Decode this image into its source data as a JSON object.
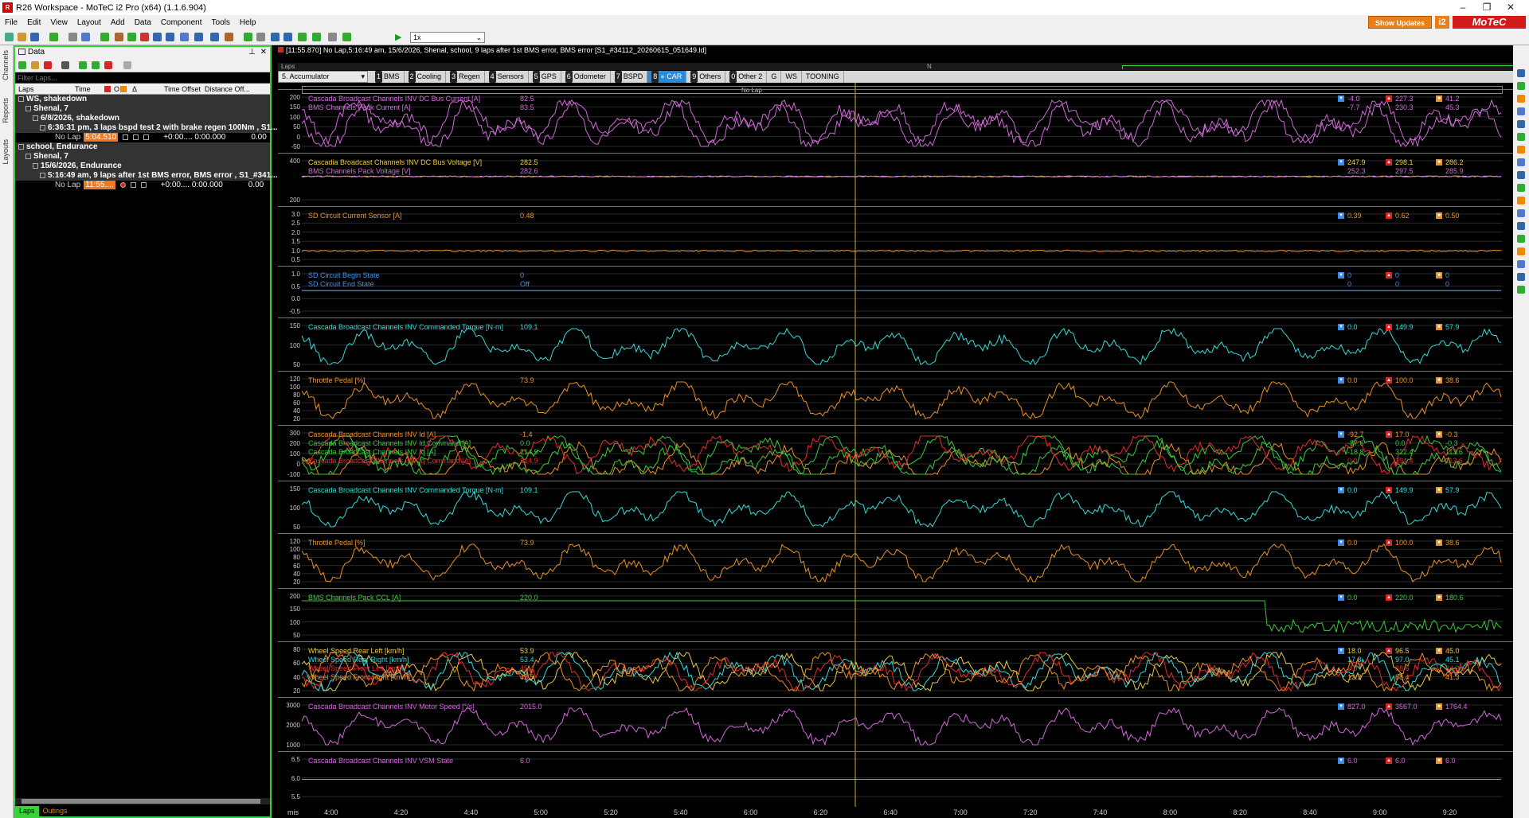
{
  "window": {
    "title": "R26 Workspace - MoTeC i2 Pro (x64) (1.1.6.904)",
    "icon": "R",
    "minimize": "–",
    "restore": "❐",
    "close": "✕"
  },
  "menu": [
    "File",
    "Edit",
    "View",
    "Layout",
    "Add",
    "Data",
    "Component",
    "Tools",
    "Help"
  ],
  "brand": {
    "show_updates": "Show Updates",
    "i2": "i2",
    "motec": "MoTeC"
  },
  "zoom": "1x",
  "left_vertical_tabs": [
    "Channels",
    "Reports",
    "Layouts"
  ],
  "data_panel": {
    "title": "Data",
    "filter_placeholder": "Filter Laps...",
    "columns": [
      "Laps",
      "Time",
      "O",
      "Δ",
      "Time Offset",
      "Distance Off..."
    ],
    "rows": [
      {
        "text": "WS, shakedown",
        "level": 0,
        "group": true
      },
      {
        "text": "Shenal, 7",
        "level": 1,
        "group": true
      },
      {
        "text": "6/8/2026, shakedown",
        "level": 2,
        "group": true
      },
      {
        "text": "6:36:31 pm, 3 laps bspd test 2 with brake regen 100Nm , S1...",
        "level": 3,
        "group": true
      },
      {
        "text": "No Lap",
        "time": "5:04.510",
        "offset": "+0:00.... 0:00.000",
        "dist": "0.00",
        "level": 4
      },
      {
        "text": "school, Endurance",
        "level": 0,
        "group": true
      },
      {
        "text": "Shenal, 7",
        "level": 1,
        "group": true
      },
      {
        "text": "15/6/2026, Endurance",
        "level": 2,
        "group": true
      },
      {
        "text": "5:16:49 am, 9 laps after 1st BMS error, BMS error , S1_#341...",
        "level": 3,
        "group": true
      },
      {
        "text": "No Lap",
        "time": "11:55....",
        "offset": "+0:00.... 0:00.000",
        "dist": "0.00",
        "level": 4
      }
    ],
    "bottom_tabs": [
      "Laps",
      "Outings"
    ]
  },
  "info_bar": "[11:55.870] No Lap,5:16:49 am, 15/6/2026, Shenal, school, 9 laps after 1st BMS error, BMS error [S1_#34112_20260615_051649.ld]",
  "laps_bar": {
    "label": "Laps",
    "marker": "N"
  },
  "worksheet_selector": "5. Accumulator",
  "tabs": [
    {
      "num": "1",
      "label": "BMS"
    },
    {
      "num": "2",
      "label": "Cooling"
    },
    {
      "num": "3",
      "label": "Regen"
    },
    {
      "num": "4",
      "label": "Sensors"
    },
    {
      "num": "5",
      "label": "GPS"
    },
    {
      "num": "6",
      "label": "Odometer"
    },
    {
      "num": "7",
      "label": "BSPD"
    },
    {
      "num": "8",
      "label": "CAR",
      "active": true
    },
    {
      "num": "9",
      "label": "Others"
    },
    {
      "num": "0",
      "label": "Other 2"
    },
    {
      "num": "",
      "label": "G"
    },
    {
      "num": "",
      "label": "WS"
    },
    {
      "num": "",
      "label": "TOONING"
    }
  ],
  "no_lap_label": "No Lap",
  "x_axis": {
    "unit": "mis",
    "ticks": [
      "4:00",
      "4:20",
      "4:40",
      "5:00",
      "5:20",
      "5:40",
      "6:00",
      "6:20",
      "6:40",
      "7:00",
      "7:20",
      "7:40",
      "8:00",
      "8:20",
      "8:40",
      "9:00",
      "9:20"
    ]
  },
  "panels": [
    {
      "yticks": [
        "200",
        "150",
        "100",
        "50",
        "0",
        "-50"
      ],
      "channels": [
        {
          "name": "Cascada Broadcast Channels INV DC Bus Current [A]",
          "value": "82.5",
          "min": "-4.0",
          "max": "227.3",
          "avg": "41.2",
          "color": "#d06ad8"
        },
        {
          "name": "BMS Channels Pack Current [A]",
          "value": "83.5",
          "min": "-7.7",
          "max": "230.3",
          "avg": "45.3",
          "color": "#d06ad8"
        }
      ]
    },
    {
      "yticks": [
        "400",
        "200"
      ],
      "channels": [
        {
          "name": "Cascadia Broadcast Channels INV DC Bus Voltage [V]",
          "value": "282.5",
          "min": "247.9",
          "max": "298.1",
          "avg": "286.2",
          "color": "#e8c84a"
        },
        {
          "name": "BMS Channels Pack Voltage [V]",
          "value": "282.6",
          "min": "252.3",
          "max": "297.5",
          "avg": "285.9",
          "color": "#d06ad8"
        }
      ]
    },
    {
      "yticks": [
        "3.0",
        "2.5",
        "2.0",
        "1.5",
        "1.0",
        "0.5"
      ],
      "channels": [
        {
          "name": "SD Circuit Current Sensor [A]",
          "value": "0.48",
          "min": "0.39",
          "max": "0.62",
          "avg": "0.50",
          "color": "#e8902a"
        }
      ]
    },
    {
      "yticks": [
        "1.0",
        "0.5",
        "0.0",
        "-0.5"
      ],
      "channels": [
        {
          "name": "SD Circuit Begin State",
          "value": "0",
          "min": "0",
          "max": "0",
          "avg": "0",
          "color": "#4a90e8"
        },
        {
          "name": "SD Circuit End State",
          "value": "Off",
          "min": "0",
          "max": "0",
          "avg": "0",
          "color": "#4a90e8"
        }
      ]
    },
    {
      "yticks": [
        "150",
        "100",
        "50"
      ],
      "channels": [
        {
          "name": "Cascada Broadcast Channels INV Commanded Torque [N·m]",
          "value": "109.1",
          "min": "0.0",
          "max": "149.9",
          "avg": "57.9",
          "color": "#38d8d8"
        }
      ]
    },
    {
      "yticks": [
        "120",
        "100",
        "80",
        "60",
        "40",
        "20"
      ],
      "channels": [
        {
          "name": "Throttle Pedal [%]",
          "value": "73.9",
          "min": "0.0",
          "max": "100.0",
          "avg": "38.6",
          "color": "#e8902a"
        }
      ]
    },
    {
      "yticks": [
        "300",
        "200",
        "100",
        "0",
        "-100"
      ],
      "channels": [
        {
          "name": "Cascada Broadcast Channels INV Id [A]",
          "value": "-1.4",
          "min": "-92.7",
          "max": "17.0",
          "avg": "-0.3",
          "color": "#e8902a"
        },
        {
          "name": "Cascada Broadcast Channels INV Id Command [A]",
          "value": "0.0",
          "min": "-87.6",
          "max": "0.0",
          "avg": "-0.3",
          "color": "#3cc83c"
        },
        {
          "name": "Cascada Broadcast Channels INV Iq [A]",
          "value": "214.9",
          "min": "-18.8",
          "max": "322.4",
          "avg": "113.6",
          "color": "#3cc83c"
        },
        {
          "name": "Cascada Broadcast Channels INV Iq Command [A]",
          "value": "214.9",
          "min": "0.0",
          "max": "394.4",
          "avg": "113.6",
          "color": "#e82a2a"
        }
      ]
    },
    {
      "yticks": [
        "150",
        "100",
        "50"
      ],
      "channels": [
        {
          "name": "Cascada Broadcast Channels INV Commanded Torque [N·m]",
          "value": "109.1",
          "min": "0.0",
          "max": "149.9",
          "avg": "57.9",
          "color": "#38d8d8"
        }
      ]
    },
    {
      "yticks": [
        "120",
        "100",
        "80",
        "60",
        "40",
        "20"
      ],
      "channels": [
        {
          "name": "Throttle Pedal [%]",
          "value": "73.9",
          "min": "0.0",
          "max": "100.0",
          "avg": "38.6",
          "color": "#e8902a"
        }
      ]
    },
    {
      "yticks": [
        "200",
        "150",
        "100",
        "50"
      ],
      "channels": [
        {
          "name": "BMS Channels Pack CCL [A]",
          "value": "220.0",
          "min": "0.0",
          "max": "220.0",
          "avg": "180.6",
          "color": "#3cc83c"
        }
      ]
    },
    {
      "yticks": [
        "80",
        "60",
        "40",
        "20"
      ],
      "channels": [
        {
          "name": "Wheel Speed Rear Left [km/h]",
          "value": "53.9",
          "min": "18.0",
          "max": "96.5",
          "avg": "45.0",
          "color": "#e8c84a"
        },
        {
          "name": "Wheel Speed Rear Right [km/h]",
          "value": "53.4",
          "min": "17.8",
          "max": "97.0",
          "avg": "45.1",
          "color": "#38d8d8"
        },
        {
          "name": "Wheel Speed Front Left [km/h]",
          "value": "45.4",
          "min": "0.0",
          "max": "88.6",
          "avg": "34.2",
          "color": "#e82a2a"
        },
        {
          "name": "Wheel Speed Front Right [km/h]",
          "value": "42.5",
          "min": "12.2",
          "max": "88.4",
          "avg": "41.3",
          "color": "#e8902a"
        }
      ]
    },
    {
      "yticks": [
        "3000",
        "2000",
        "1000"
      ],
      "channels": [
        {
          "name": "Cascada Broadcast Channels INV Motor Speed [°/s]",
          "value": "2015.0",
          "min": "827.0",
          "max": "3567.0",
          "avg": "1764.4",
          "color": "#d06ad8"
        }
      ]
    },
    {
      "yticks": [
        "6.5",
        "6.0",
        "5.5"
      ],
      "channels": [
        {
          "name": "Cascada Broadcast Channels INV VSM State",
          "value": "6.0",
          "min": "6.0",
          "max": "6.0",
          "avg": "6.0",
          "color": "#d06ad8"
        }
      ]
    }
  ]
}
